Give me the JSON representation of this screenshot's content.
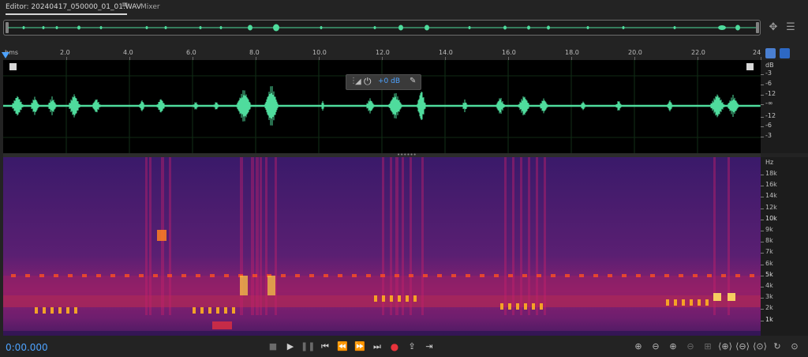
{
  "tabs": {
    "editor_label": "Editor: 20240417_050000_01_01.WAV",
    "menu_glyph": "≡",
    "mixer_label": "Mixer"
  },
  "ruler": {
    "unit_label": "hms",
    "ticks": [
      "2.0",
      "4.0",
      "6.0",
      "8.0",
      "10.0",
      "12.0",
      "14.0",
      "16.0",
      "18.0",
      "20.0",
      "22.0",
      "24"
    ]
  },
  "waveform_scale": {
    "unit": "dB",
    "labels": [
      "-3",
      "-6",
      "-12",
      "-∞",
      "-12",
      "-6",
      "-3"
    ]
  },
  "hud": {
    "value": "+0 dB"
  },
  "spectral_scale": {
    "unit": "Hz",
    "labels": [
      "18k",
      "16k",
      "14k",
      "12k",
      "10k",
      "9k",
      "8k",
      "7k",
      "6k",
      "5k",
      "4k",
      "3k",
      "2k",
      "1k"
    ]
  },
  "transport": {
    "time": "0:00.000"
  },
  "icons": {
    "stop": "stop-icon",
    "play": "play-icon",
    "pause": "pause-icon",
    "to_start": "skip-to-start-icon",
    "rewind": "rewind-icon",
    "fast_forward": "fast-forward-icon",
    "to_end": "skip-to-end-icon",
    "record": "record-icon",
    "loop": "loop-icon",
    "skip": "skip-selection-icon"
  },
  "colors": {
    "waveform": "#4fdc9d",
    "accent": "#4ea3ff",
    "record": "#e8333b"
  }
}
